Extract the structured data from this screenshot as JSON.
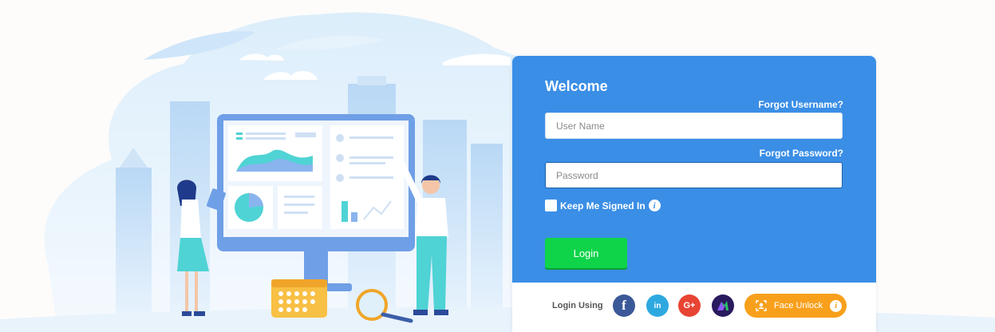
{
  "login": {
    "welcome": "Welcome",
    "forgot_username": "Forgot Username?",
    "forgot_password": "Forgot Password?",
    "username_placeholder": "User Name",
    "password_placeholder": "Password",
    "keep_signed_in": "Keep Me Signed In",
    "login_button": "Login",
    "login_using": "Login Using",
    "face_unlock": "Face Unlock"
  },
  "social": {
    "facebook": "f",
    "linkedin": "in",
    "google": "G+",
    "other": "N"
  },
  "colors": {
    "card": "#3a8ee6",
    "login_button": "#0fd44a",
    "face_unlock": "#f8a01c",
    "facebook": "#3b5998",
    "linkedin": "#2ea9e0",
    "google": "#e84434"
  }
}
